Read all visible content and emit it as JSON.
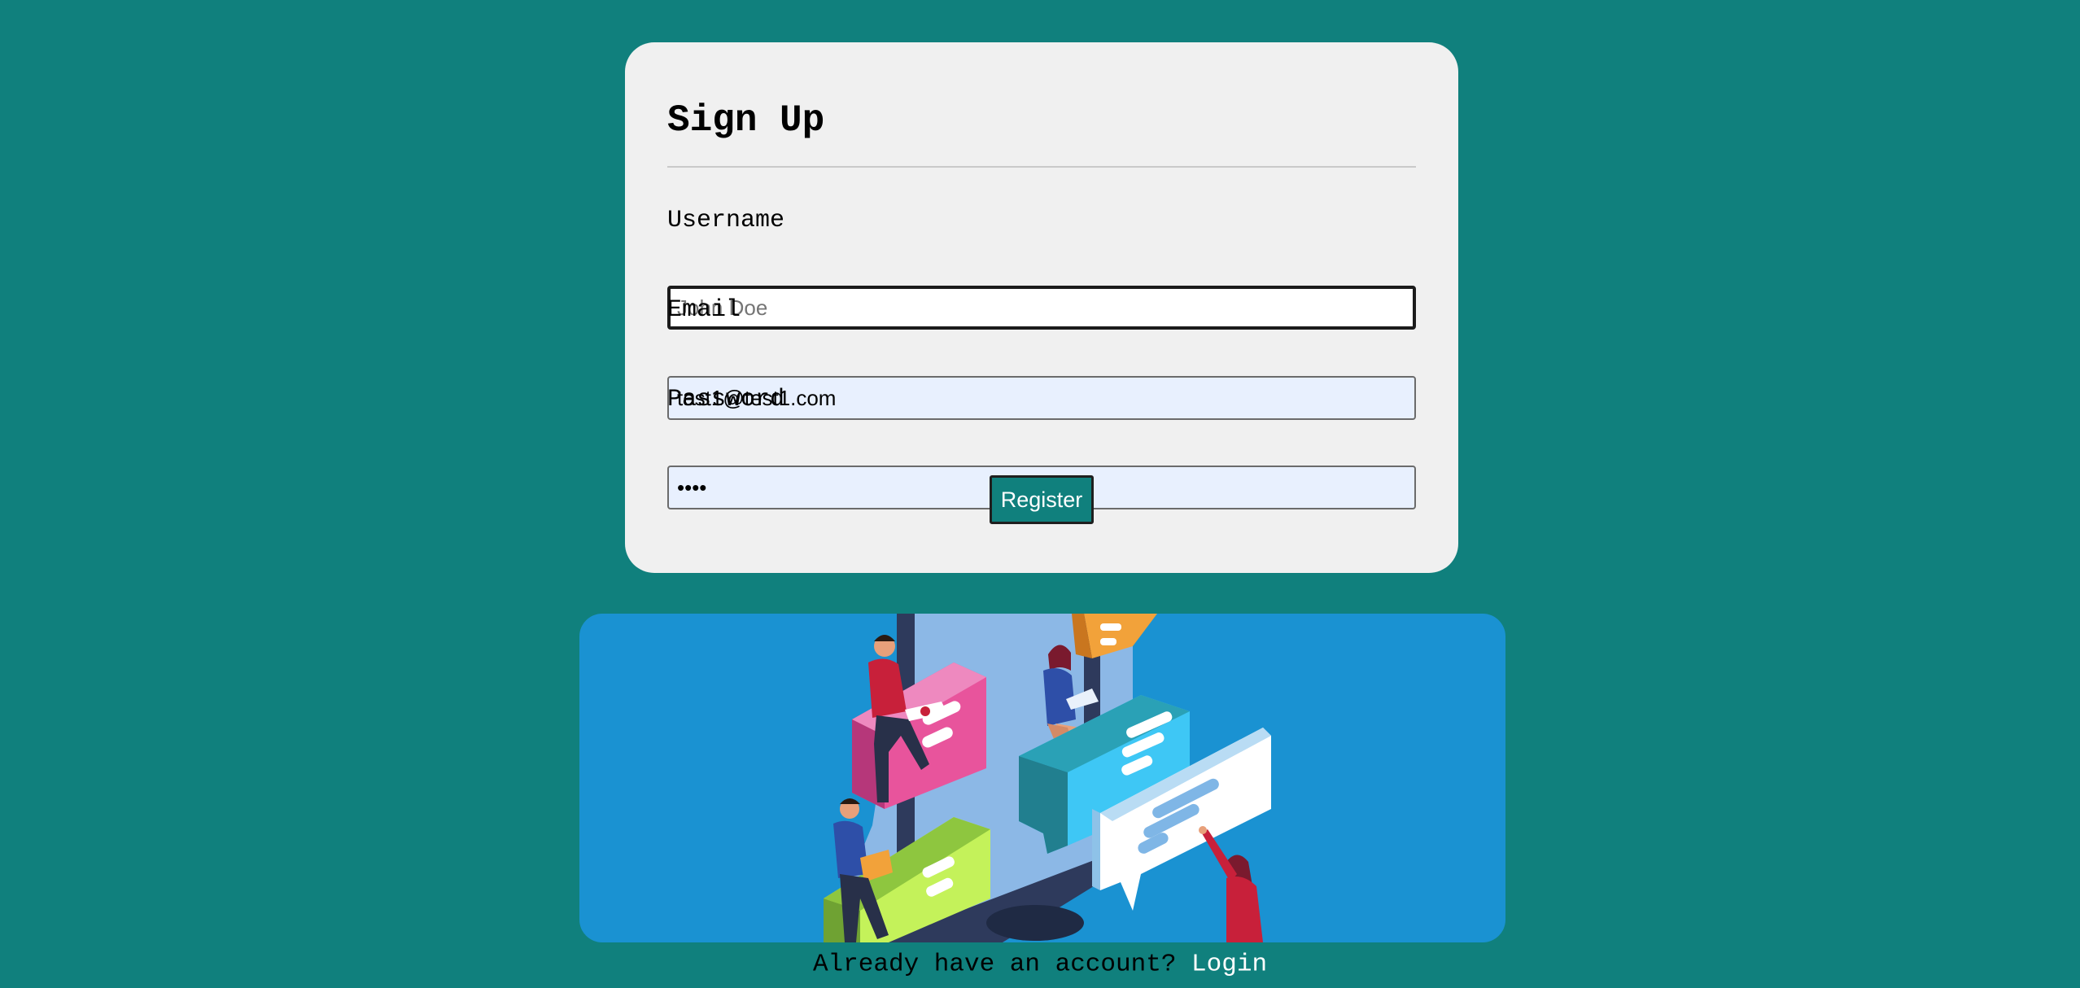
{
  "signup": {
    "title": "Sign Up",
    "username": {
      "label": "Username",
      "placeholder": "John Doe",
      "value": ""
    },
    "email": {
      "label": "Email",
      "value": "test1@test1.com"
    },
    "password": {
      "label": "Password",
      "value": "••••"
    },
    "register_label": "Register"
  },
  "footer": {
    "prompt": "Already have an account? ",
    "link_label": "Login"
  },
  "colors": {
    "page_background": "#10807d",
    "card_background": "#f0f0f0",
    "button_background": "#10807d",
    "illustration_background": "#1a92d2",
    "autofill_background": "#e8f0fe"
  },
  "icons": {
    "illustration": "people-chat-illustration"
  }
}
